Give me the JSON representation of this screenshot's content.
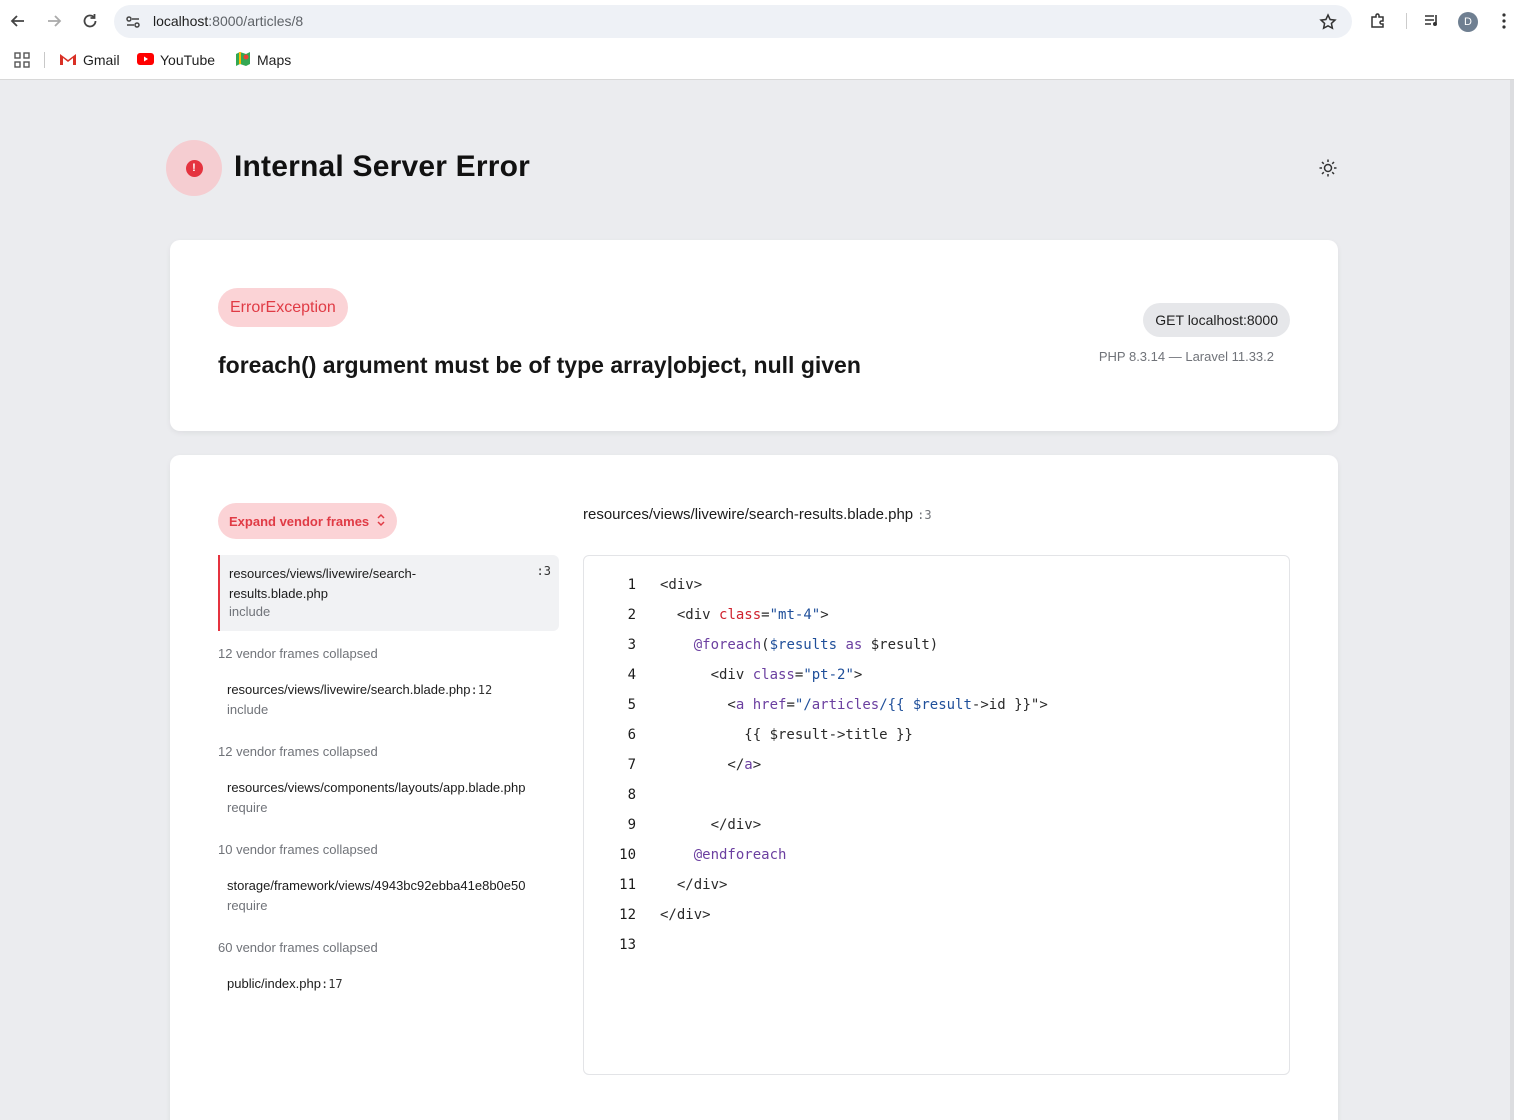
{
  "browser": {
    "url_host": "localhost",
    "url_rest": ":8000/articles/8",
    "avatar_letter": "D",
    "bookmarks": [
      {
        "label": "Gmail",
        "icon": "gmail-icon"
      },
      {
        "label": "YouTube",
        "icon": "youtube-icon"
      },
      {
        "label": "Maps",
        "icon": "maps-icon"
      }
    ]
  },
  "header": {
    "title": "Internal Server Error",
    "icon": "alert-icon",
    "alert_glyph": "!"
  },
  "exception": {
    "type": "ErrorException",
    "message": "foreach() argument must be of type array|object, null given",
    "request": "GET localhost:8000",
    "versions": "PHP 8.3.14 — Laravel 11.33.2"
  },
  "frames": {
    "expand_label": "Expand vendor frames",
    "active": {
      "path": "resources/views/livewire/search-results.blade.php",
      "line": ":3",
      "call": "include"
    },
    "groups": [
      {
        "collapsed": "12 vendor frames collapsed",
        "path": "resources/views/livewire/search.blade.php",
        "line": ":12",
        "call": "include"
      },
      {
        "collapsed": "12 vendor frames collapsed",
        "path": "resources/views/components/layouts/app.blade.php",
        "line": "",
        "call": "require"
      },
      {
        "collapsed": "10 vendor frames collapsed",
        "path": "storage/framework/views/4943bc92ebba41e8b0e50",
        "line": "",
        "call": "require"
      },
      {
        "collapsed": "60 vendor frames collapsed",
        "path": "public/index.php",
        "line": ":17",
        "call": ""
      }
    ]
  },
  "code": {
    "file": "resources/views/livewire/search-results.blade.php",
    "line": ":3",
    "line_numbers": [
      "1",
      "2",
      "3",
      "4",
      "5",
      "6",
      "7",
      "8",
      "9",
      "10",
      "11",
      "12",
      "13"
    ]
  },
  "colors": {
    "accent_red": "#e5333f",
    "badge_pink": "#fbd3d6",
    "page_bg": "#ebecef"
  }
}
